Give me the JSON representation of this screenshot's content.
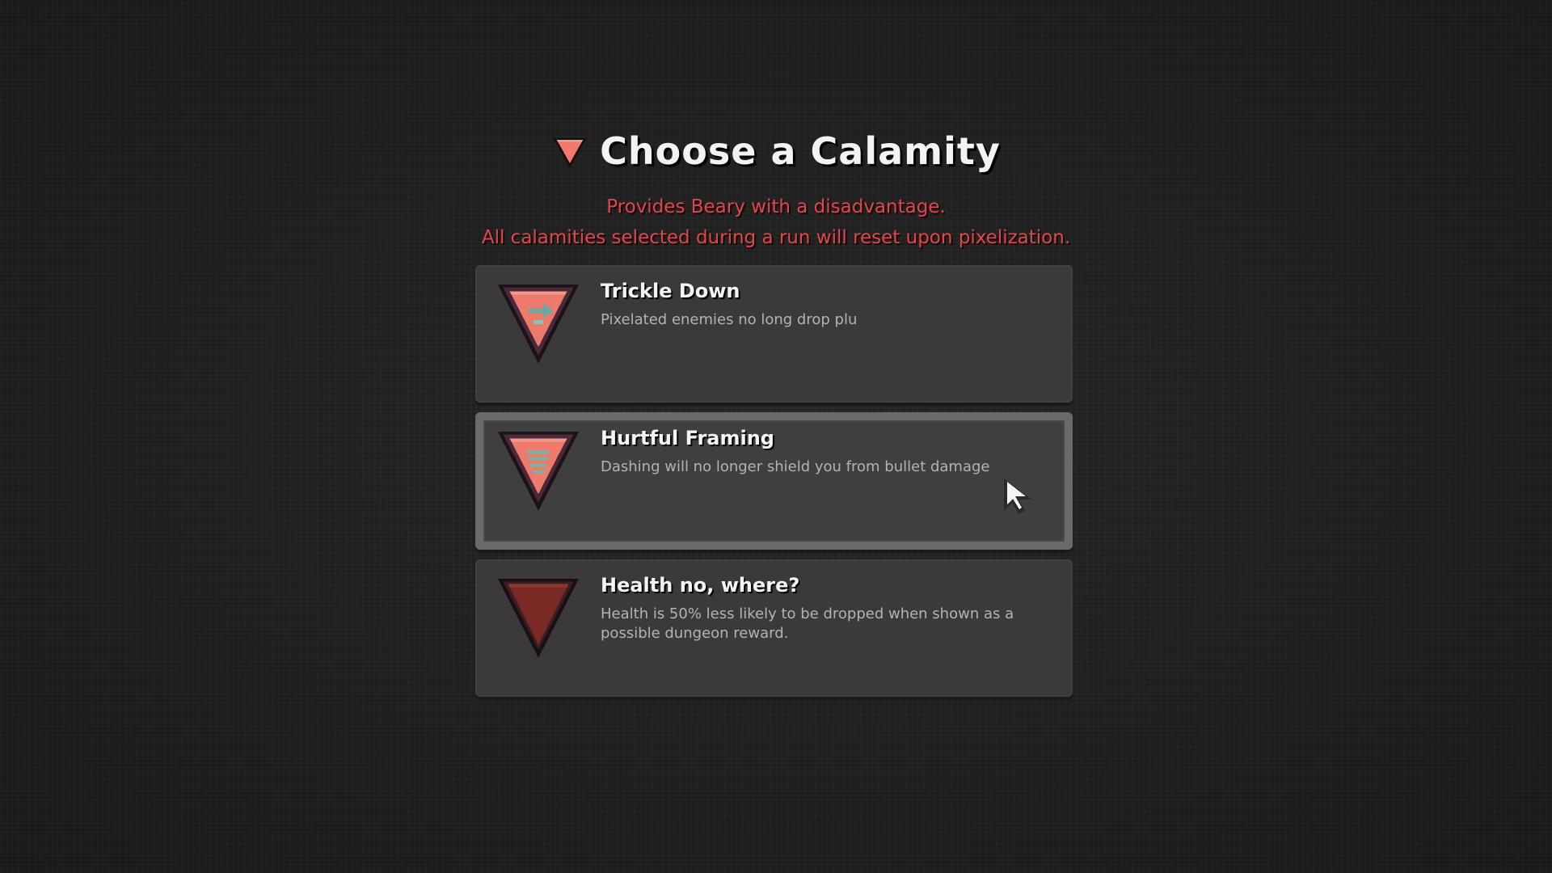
{
  "header": {
    "title": "Choose a Calamity",
    "icon": "red-inverted-triangle-icon"
  },
  "subtitle": {
    "line1": "Provides Beary with a disadvantage.",
    "line2": "All calamities selected during a run will reset upon pixelization."
  },
  "calamities": [
    {
      "name": "Trickle Down",
      "description": "Pixelated enemies no long drop plu",
      "icon": "calamity-triangle-arrow-icon",
      "selected": false
    },
    {
      "name": "Hurtful Framing",
      "description": "Dashing will no longer shield you from bullet damage",
      "icon": "calamity-triangle-spring-icon",
      "selected": true
    },
    {
      "name": "Health no, where?",
      "description": "Health is 50% less likely to be dropped when shown as a possible dungeon reward.",
      "icon": "calamity-triangle-dark-icon",
      "selected": false
    }
  ],
  "colors": {
    "accent_red": "#e0464b",
    "triangle_salmon": "#f07a6e",
    "triangle_dark": "#7a2a24",
    "card_bg": "#3a3a3a",
    "selected_border": "#6a6a6a"
  }
}
